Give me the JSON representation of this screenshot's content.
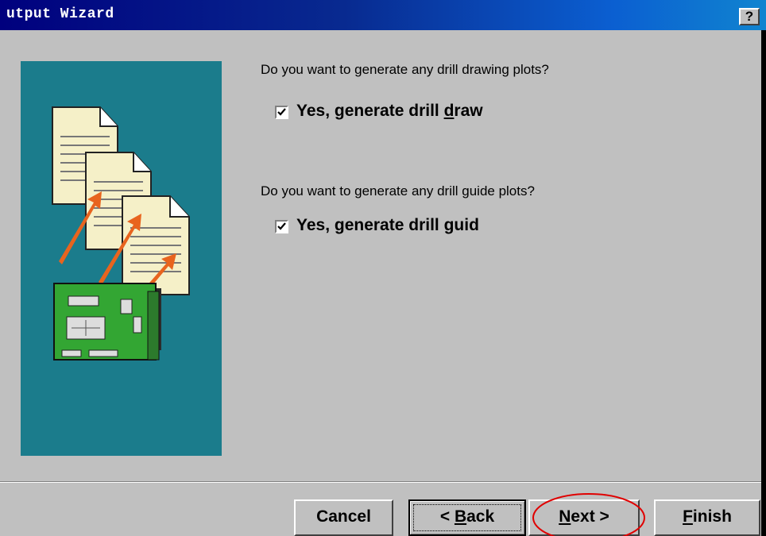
{
  "window": {
    "title": "utput Wizard",
    "help_label": "?"
  },
  "content": {
    "drill_drawing": {
      "question": "Do you want to generate any drill drawing plots?",
      "checkbox_label_prefix": "Yes, generate drill ",
      "checkbox_label_accel": "d",
      "checkbox_label_suffix": "raw",
      "checked": true
    },
    "drill_guide": {
      "question": "Do you want to generate any drill guide plots?",
      "checkbox_label_prefix": "Yes, generate drill ",
      "checkbox_label_accel": "g",
      "checkbox_label_suffix": "uid",
      "checked": true
    }
  },
  "buttons": {
    "cancel": {
      "label": "Cancel"
    },
    "back": {
      "prefix": "< ",
      "accel": "B",
      "suffix": "ack"
    },
    "next": {
      "accel": "N",
      "suffix": "ext >"
    },
    "finish": {
      "accel": "F",
      "suffix": "inish"
    }
  },
  "colors": {
    "panel_teal": "#1b7c8c",
    "dialog_gray": "#c0c0c0",
    "annotation_red": "#e00000",
    "pcb_green": "#33a633",
    "arrow_orange": "#e8641e"
  },
  "icons": [
    "help-icon",
    "document-icon",
    "arrow-icon",
    "circuit-board-icon",
    "checkmark-icon"
  ]
}
